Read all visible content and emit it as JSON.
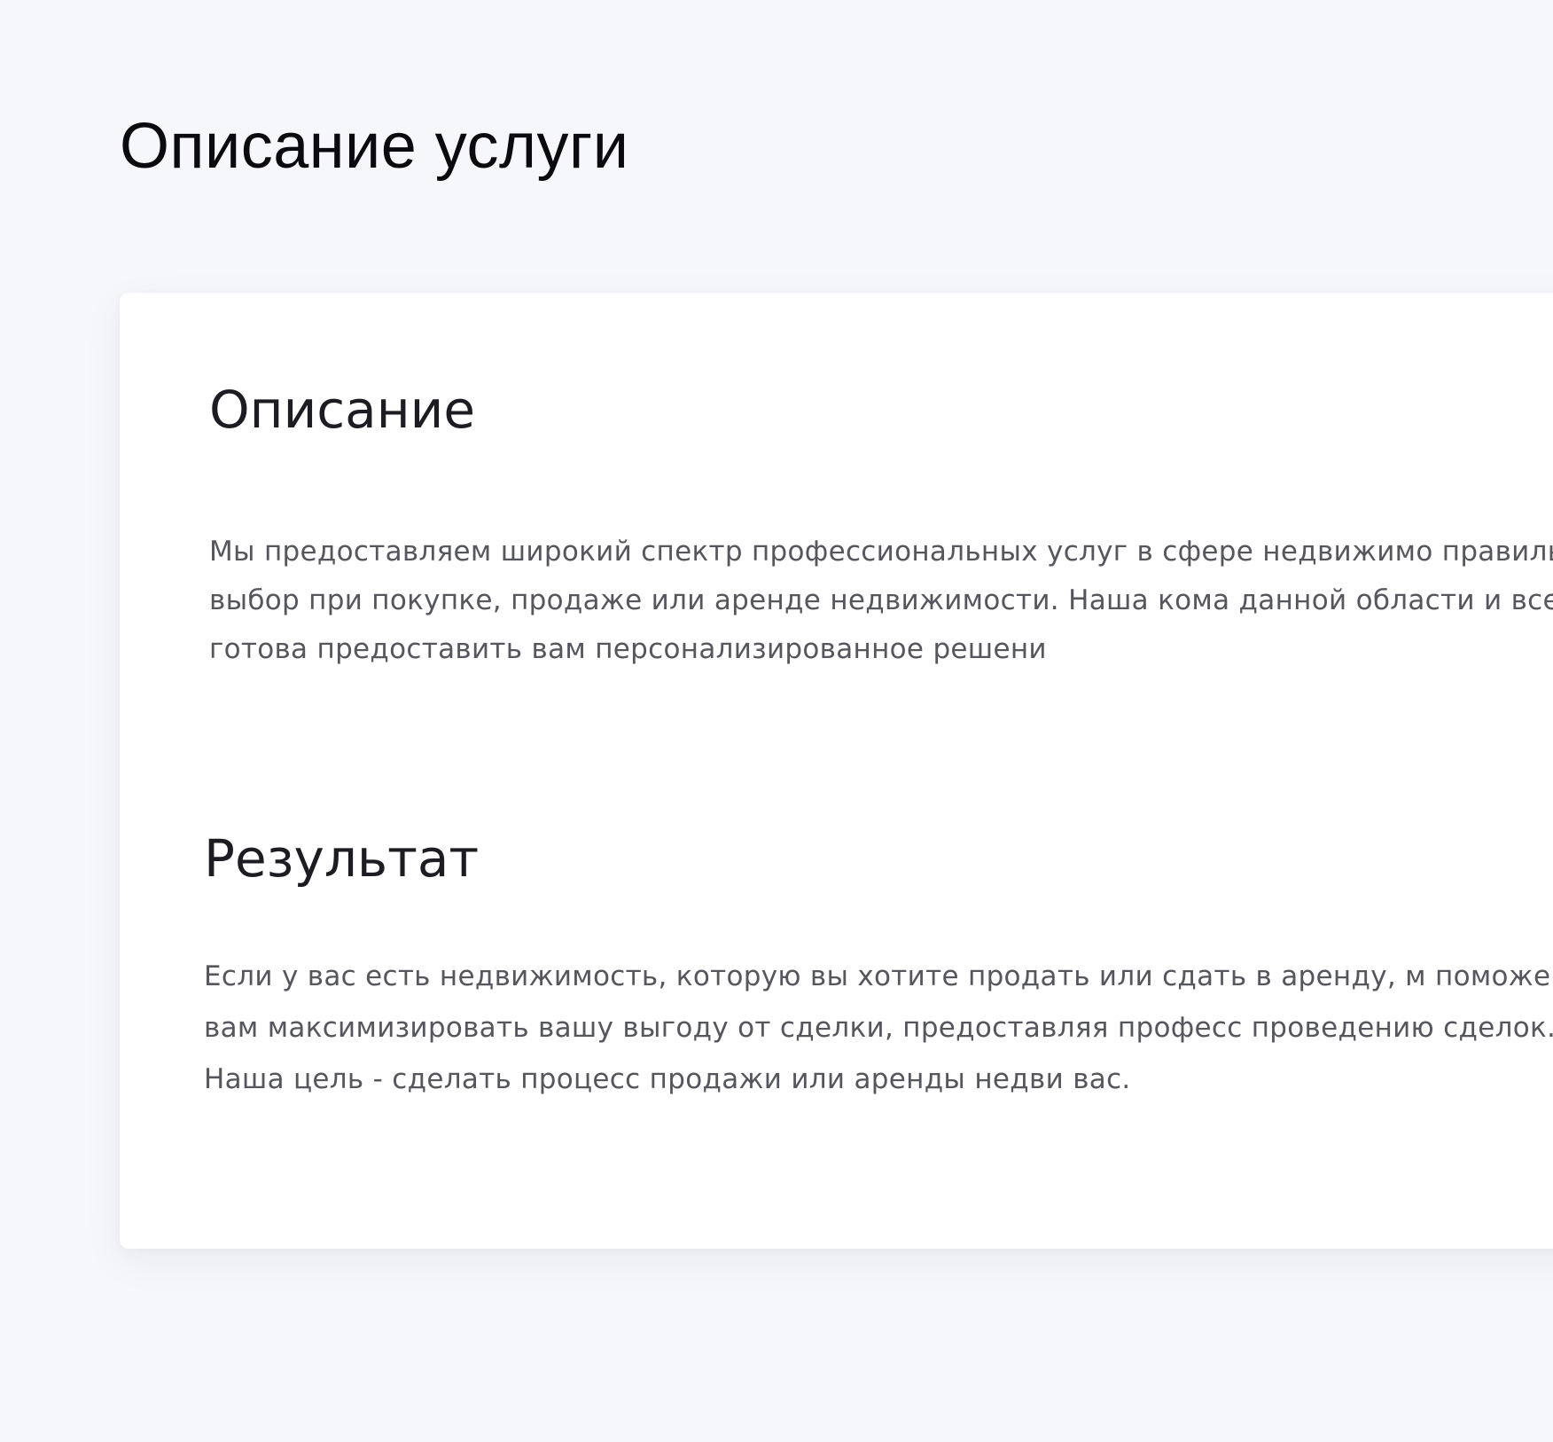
{
  "page": {
    "title": "Описание услуги"
  },
  "card": {
    "description": {
      "heading": "Описание",
      "text": "Мы предоставляем широкий спектр профессиональных услуг в сфере недвижимо правильный выбор при покупке, продаже или аренде недвижимости. Наша кома данной области и всегда готова предоставить вам персонализированное решени"
    },
    "result": {
      "heading": "Результат",
      "text": "Если у вас есть недвижимость, которую вы хотите продать или сдать в аренду, м поможем вам максимизировать вашу выгоду от сделки, предоставляя професс проведению сделок. Наша цель - сделать процесс продажи или аренды недви вас."
    }
  },
  "colors": {
    "page_background": "#f6f7fb",
    "card_background": "#ffffff",
    "title_text": "#0b0b0f",
    "heading_text": "#1c1c22",
    "body_text": "#55565e"
  }
}
